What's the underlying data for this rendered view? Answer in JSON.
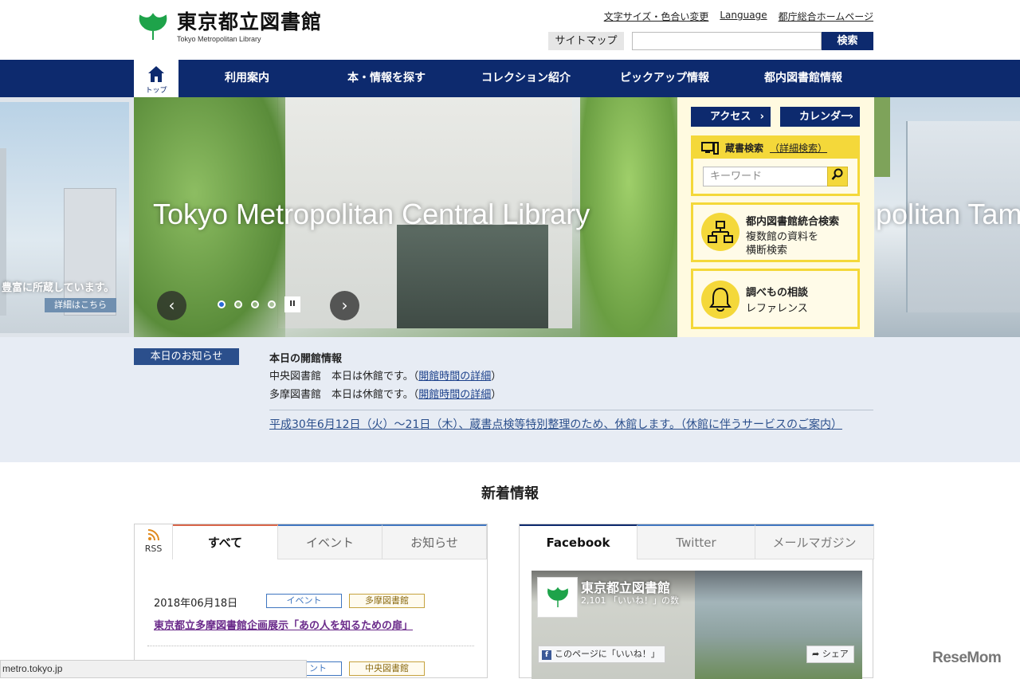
{
  "header": {
    "logo_title": "東京都立図書館",
    "logo_sub": "Tokyo Metropolitan Library",
    "util_links": [
      "文字サイズ・色合い変更",
      "Language",
      "都庁総合ホームページ"
    ],
    "sitemap_label": "サイトマップ",
    "search_placeholder": "",
    "search_button": "検索"
  },
  "nav": {
    "home_label": "トップ",
    "items": [
      "利用案内",
      "本・情報を探す",
      "コレクション紹介",
      "ピックアップ情報",
      "都内図書館情報"
    ]
  },
  "hero": {
    "left_caption": "豊富に所蔵しています。",
    "left_button": "詳細はこちら",
    "slide_title": "Tokyo Metropolitan Central Library",
    "right_caption": "politan Tam",
    "prev_label": "‹",
    "next_label": "›",
    "pause_label": "II"
  },
  "panel": {
    "access_label": "アクセス",
    "calendar_label": "カレンダー",
    "catalog_title": "蔵書検索",
    "catalog_detail": "（詳細検索）",
    "keyword_placeholder": "キーワード",
    "integrated_title": "都内図書館統合検索",
    "integrated_line1": "複数館の資料を",
    "integrated_line2": "横断検索",
    "reference_title": "調べもの相談",
    "reference_sub": "レファレンス"
  },
  "notice": {
    "badge": "本日のお知らせ",
    "heading": "本日の開館情報",
    "central_text": "中央図書館　本日は休館です。（",
    "central_link": "開館時間の詳細",
    "tama_text": "多摩図書館　本日は休館です。（",
    "tama_link": "開館時間の詳細",
    "close_paren": "）",
    "long_notice": "平成30年6月12日（火）～21日（木）、蔵書点検等特別整理のため、休館します。（休館に伴うサービスのご案内）"
  },
  "news": {
    "section_title": "新着情報",
    "rss_label": "RSS",
    "tabs": [
      "すべて",
      "イベント",
      "お知らせ"
    ],
    "items": [
      {
        "date": "2018年06月18日",
        "category": "イベント",
        "library": "多摩図書館",
        "title": "東京都立多摩図書館企画展示「あの人を知るための扉」"
      },
      {
        "date": "",
        "category": "ント",
        "library": "中央図書館",
        "title": ""
      }
    ]
  },
  "social": {
    "tabs": [
      "Facebook",
      "Twitter",
      "メールマガジン"
    ],
    "fb_name": "東京都立図書館",
    "fb_likes": "2,101 「いいね！」の数",
    "fb_like_button": "このページに「いいね！」",
    "fb_share": "シェア"
  },
  "status_url": "metro.tokyo.jp",
  "watermark": "ReseMom",
  "colors": {
    "nav": "#0d2a6e",
    "accent_yellow": "#f4d83a",
    "notice_bg": "#e7ecf4"
  }
}
